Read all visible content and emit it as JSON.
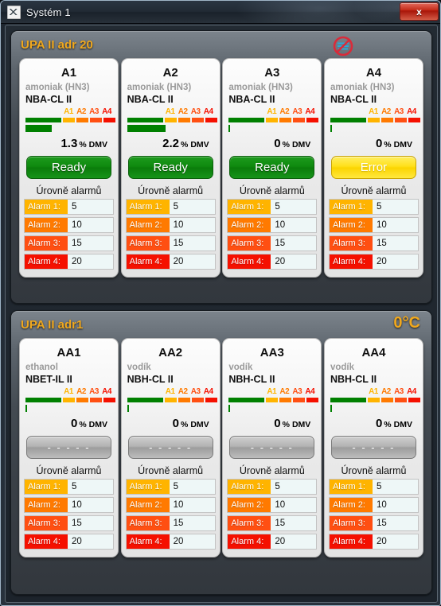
{
  "window": {
    "title": "Systém 1",
    "icon": "app-icon",
    "close_label": "x"
  },
  "panels": [
    {
      "id": "upa-ii-adr-20",
      "title": "UPA II adr 20",
      "temperature": "",
      "status_icon": "no-signal-icon",
      "cards": [
        {
          "name": "A1",
          "gas": "amoniak (HN3)",
          "model": "NBA-CL II",
          "reading_value": "1.3",
          "reading_pct": "%",
          "reading_unit": "DMV",
          "value_bar_percent": 28,
          "status": "Ready",
          "status_kind": "ready",
          "alarm_header": "Úrovně alarmů",
          "alarms": [
            {
              "label": "Alarm 1:",
              "value": "5",
              "color": "#FFB400"
            },
            {
              "label": "Alarm 2:",
              "value": "10",
              "color": "#FF7A00"
            },
            {
              "label": "Alarm 3:",
              "value": "15",
              "color": "#FF4F12"
            },
            {
              "label": "Alarm 4:",
              "value": "20",
              "color": "#F51000"
            }
          ]
        },
        {
          "name": "A2",
          "gas": "amoniak (HN3)",
          "model": "NBA-CL II",
          "reading_value": "2.2",
          "reading_pct": "%",
          "reading_unit": "DMV",
          "value_bar_percent": 42,
          "status": "Ready",
          "status_kind": "ready",
          "alarm_header": "Úrovně alarmů",
          "alarms": [
            {
              "label": "Alarm 1:",
              "value": "5",
              "color": "#FFB400"
            },
            {
              "label": "Alarm 2:",
              "value": "10",
              "color": "#FF7A00"
            },
            {
              "label": "Alarm 3:",
              "value": "15",
              "color": "#FF4F12"
            },
            {
              "label": "Alarm 4:",
              "value": "20",
              "color": "#F51000"
            }
          ]
        },
        {
          "name": "A3",
          "gas": "amoniak (HN3)",
          "model": "NBA-CL II",
          "reading_value": "0",
          "reading_pct": "%",
          "reading_unit": "DMV",
          "value_bar_percent": 1,
          "status": "Ready",
          "status_kind": "ready",
          "alarm_header": "Úrovně alarmů",
          "alarms": [
            {
              "label": "Alarm 1:",
              "value": "5",
              "color": "#FFB400"
            },
            {
              "label": "Alarm 2:",
              "value": "10",
              "color": "#FF7A00"
            },
            {
              "label": "Alarm 3:",
              "value": "15",
              "color": "#FF4F12"
            },
            {
              "label": "Alarm 4:",
              "value": "20",
              "color": "#F51000"
            }
          ]
        },
        {
          "name": "A4",
          "gas": "amoniak (HN3)",
          "model": "NBA-CL II",
          "reading_value": "0",
          "reading_pct": "%",
          "reading_unit": "DMV",
          "value_bar_percent": 1,
          "status": "Error",
          "status_kind": "error",
          "alarm_header": "Úrovně alarmů",
          "alarms": [
            {
              "label": "Alarm 1:",
              "value": "5",
              "color": "#FFB400"
            },
            {
              "label": "Alarm 2:",
              "value": "10",
              "color": "#FF7A00"
            },
            {
              "label": "Alarm 3:",
              "value": "15",
              "color": "#FF4F12"
            },
            {
              "label": "Alarm 4:",
              "value": "20",
              "color": "#F51000"
            }
          ]
        }
      ]
    },
    {
      "id": "upa-ii-adr1",
      "title": "UPA II adr1",
      "temperature": "0°C",
      "status_icon": "",
      "cards": [
        {
          "name": "AA1",
          "gas": "ethanol",
          "model": "NBET-IL II",
          "reading_value": "0",
          "reading_pct": "%",
          "reading_unit": "DMV",
          "value_bar_percent": 1,
          "status": "- - - - -",
          "status_kind": "idle",
          "alarm_header": "Úrovně alarmů",
          "alarms": [
            {
              "label": "Alarm 1:",
              "value": "5",
              "color": "#FFB400"
            },
            {
              "label": "Alarm 2:",
              "value": "10",
              "color": "#FF7A00"
            },
            {
              "label": "Alarm 3:",
              "value": "15",
              "color": "#FF4F12"
            },
            {
              "label": "Alarm 4:",
              "value": "20",
              "color": "#F51000"
            }
          ]
        },
        {
          "name": "AA2",
          "gas": "vodík",
          "model": "NBH-CL II",
          "reading_value": "0",
          "reading_pct": "%",
          "reading_unit": "DMV",
          "value_bar_percent": 1,
          "status": "- - - - -",
          "status_kind": "idle",
          "alarm_header": "Úrovně alarmů",
          "alarms": [
            {
              "label": "Alarm 1:",
              "value": "5",
              "color": "#FFB400"
            },
            {
              "label": "Alarm 2:",
              "value": "10",
              "color": "#FF7A00"
            },
            {
              "label": "Alarm 3:",
              "value": "15",
              "color": "#FF4F12"
            },
            {
              "label": "Alarm 4:",
              "value": "20",
              "color": "#F51000"
            }
          ]
        },
        {
          "name": "AA3",
          "gas": "vodík",
          "model": "NBH-CL II",
          "reading_value": "0",
          "reading_pct": "%",
          "reading_unit": "DMV",
          "value_bar_percent": 1,
          "status": "- - - - -",
          "status_kind": "idle",
          "alarm_header": "Úrovně alarmů",
          "alarms": [
            {
              "label": "Alarm 1:",
              "value": "5",
              "color": "#FFB400"
            },
            {
              "label": "Alarm 2:",
              "value": "10",
              "color": "#FF7A00"
            },
            {
              "label": "Alarm 3:",
              "value": "15",
              "color": "#FF4F12"
            },
            {
              "label": "Alarm 4:",
              "value": "20",
              "color": "#F51000"
            }
          ]
        },
        {
          "name": "AA4",
          "gas": "vodík",
          "model": "NBH-CL II",
          "reading_value": "0",
          "reading_pct": "%",
          "reading_unit": "DMV",
          "value_bar_percent": 1,
          "status": "- - - - -",
          "status_kind": "idle",
          "alarm_header": "Úrovně alarmů",
          "alarms": [
            {
              "label": "Alarm 1:",
              "value": "5",
              "color": "#FFB400"
            },
            {
              "label": "Alarm 2:",
              "value": "10",
              "color": "#FF7A00"
            },
            {
              "label": "Alarm 3:",
              "value": "15",
              "color": "#FF4F12"
            },
            {
              "label": "Alarm 4:",
              "value": "20",
              "color": "#F51000"
            }
          ]
        }
      ]
    }
  ],
  "scale": {
    "labels": [
      "A1",
      "A2",
      "A3",
      "A4"
    ],
    "label_colors": [
      "#FFB400",
      "#FF7A00",
      "#FF4F12",
      "#F51000"
    ],
    "segment_colors": [
      "#FFB400",
      "#FF7A00",
      "#FF4F12",
      "#F51000"
    ],
    "base_color": "#008000"
  }
}
